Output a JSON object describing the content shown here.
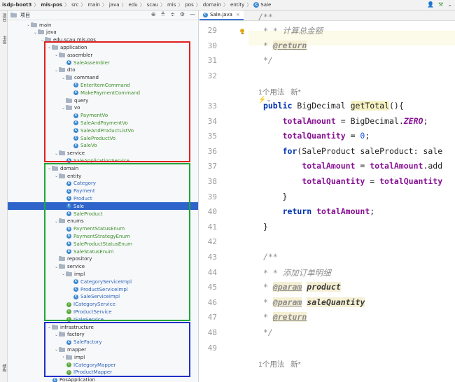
{
  "breadcrumb": {
    "items": [
      "isdp-boot3",
      "mis-pos",
      "src",
      "main",
      "java",
      "edu",
      "scau",
      "mis",
      "pos",
      "domain",
      "entity",
      "Sale"
    ],
    "separator": "〉"
  },
  "left_strip": {
    "labels": [
      "项目",
      "书签",
      "结构"
    ]
  },
  "project_panel": {
    "title": "项目",
    "tools": [
      "⊕",
      "≚",
      "≑",
      "⚙",
      "—"
    ]
  },
  "tree": {
    "rows": [
      {
        "label": "main",
        "icon": "folder",
        "depth": 0,
        "arrow": "⌄",
        "color": ""
      },
      {
        "label": "java",
        "icon": "folder",
        "depth": 1,
        "arrow": "⌄",
        "color": ""
      },
      {
        "label": "edu.scau.mis.pos",
        "icon": "folder",
        "depth": 2,
        "arrow": "⌄",
        "color": ""
      },
      {
        "label": "application",
        "icon": "folder",
        "depth": 3,
        "arrow": "⌄",
        "color": ""
      },
      {
        "label": "assembler",
        "icon": "folder",
        "depth": 4,
        "arrow": "⌄",
        "color": ""
      },
      {
        "label": "SaleAssembler",
        "icon": "class",
        "depth": 5,
        "arrow": "",
        "color": "green"
      },
      {
        "label": "dto",
        "icon": "folder",
        "depth": 4,
        "arrow": "⌄",
        "color": ""
      },
      {
        "label": "command",
        "icon": "folder",
        "depth": 5,
        "arrow": "⌄",
        "color": ""
      },
      {
        "label": "EnterItemCommand",
        "icon": "class",
        "depth": 6,
        "arrow": "",
        "color": "green"
      },
      {
        "label": "MakePaymentCommand",
        "icon": "class",
        "depth": 6,
        "arrow": "",
        "color": "green"
      },
      {
        "label": "query",
        "icon": "folder",
        "depth": 5,
        "arrow": "",
        "color": ""
      },
      {
        "label": "vo",
        "icon": "folder",
        "depth": 5,
        "arrow": "⌄",
        "color": ""
      },
      {
        "label": "PaymentVo",
        "icon": "class",
        "depth": 6,
        "arrow": "",
        "color": "green"
      },
      {
        "label": "SaleAndPaymentVo",
        "icon": "class",
        "depth": 6,
        "arrow": "",
        "color": "green"
      },
      {
        "label": "SaleAndProductListVo",
        "icon": "class",
        "depth": 6,
        "arrow": "",
        "color": "green"
      },
      {
        "label": "SaleProductVo",
        "icon": "class",
        "depth": 6,
        "arrow": "",
        "color": "green"
      },
      {
        "label": "SaleVo",
        "icon": "class",
        "depth": 6,
        "arrow": "",
        "color": "green"
      },
      {
        "label": "service",
        "icon": "folder",
        "depth": 4,
        "arrow": "⌄",
        "color": ""
      },
      {
        "label": "SaleApplicationService",
        "icon": "class",
        "depth": 5,
        "arrow": "",
        "color": "green"
      },
      {
        "label": "domain",
        "icon": "folder",
        "depth": 3,
        "arrow": "⌄",
        "color": ""
      },
      {
        "label": "entity",
        "icon": "folder",
        "depth": 4,
        "arrow": "⌄",
        "color": ""
      },
      {
        "label": "Category",
        "icon": "class",
        "depth": 5,
        "arrow": "",
        "color": "blue"
      },
      {
        "label": "Payment",
        "icon": "class",
        "depth": 5,
        "arrow": "",
        "color": "blue"
      },
      {
        "label": "Product",
        "icon": "class",
        "depth": 5,
        "arrow": "",
        "color": "blue"
      },
      {
        "label": "Sale",
        "icon": "class",
        "depth": 5,
        "arrow": "",
        "color": "",
        "selected": true
      },
      {
        "label": "SaleProduct",
        "icon": "class",
        "depth": 5,
        "arrow": "",
        "color": "green"
      },
      {
        "label": "enums",
        "icon": "folder",
        "depth": 4,
        "arrow": "⌄",
        "color": ""
      },
      {
        "label": "PaymentStatusEnum",
        "icon": "enum",
        "depth": 5,
        "arrow": "",
        "color": "green"
      },
      {
        "label": "PaymentStrategyEnum",
        "icon": "enum",
        "depth": 5,
        "arrow": "",
        "color": "green"
      },
      {
        "label": "SaleProductStatusEnum",
        "icon": "enum",
        "depth": 5,
        "arrow": "",
        "color": "green"
      },
      {
        "label": "SaleStatusEnum",
        "icon": "enum",
        "depth": 5,
        "arrow": "",
        "color": "green"
      },
      {
        "label": "repository",
        "icon": "folder",
        "depth": 4,
        "arrow": "",
        "color": ""
      },
      {
        "label": "service",
        "icon": "folder",
        "depth": 4,
        "arrow": "⌄",
        "color": ""
      },
      {
        "label": "impl",
        "icon": "folder",
        "depth": 5,
        "arrow": "⌄",
        "color": ""
      },
      {
        "label": "CategoryServiceImpl",
        "icon": "class",
        "depth": 6,
        "arrow": "",
        "color": "blue"
      },
      {
        "label": "ProductServiceImpl",
        "icon": "class",
        "depth": 6,
        "arrow": "",
        "color": "blue"
      },
      {
        "label": "SaleServiceImpl",
        "icon": "class",
        "depth": 6,
        "arrow": "",
        "color": "blue"
      },
      {
        "label": "ICategoryService",
        "icon": "interface",
        "depth": 5,
        "arrow": "",
        "color": "blue"
      },
      {
        "label": "IProductService",
        "icon": "interface",
        "depth": 5,
        "arrow": "",
        "color": "blue"
      },
      {
        "label": "ISaleService",
        "icon": "interface",
        "depth": 5,
        "arrow": "",
        "color": "blue"
      },
      {
        "label": "infrastructure",
        "icon": "folder",
        "depth": 3,
        "arrow": "⌄",
        "color": ""
      },
      {
        "label": "factory",
        "icon": "folder",
        "depth": 4,
        "arrow": "⌄",
        "color": ""
      },
      {
        "label": "SaleFactory",
        "icon": "class",
        "depth": 5,
        "arrow": "",
        "color": "blue"
      },
      {
        "label": "mapper",
        "icon": "folder",
        "depth": 4,
        "arrow": "⌄",
        "color": ""
      },
      {
        "label": "impl",
        "icon": "folder",
        "depth": 5,
        "arrow": "›",
        "color": ""
      },
      {
        "label": "ICategoryMapper",
        "icon": "interface",
        "depth": 5,
        "arrow": "",
        "color": "blue"
      },
      {
        "label": "IProductMapper",
        "icon": "interface",
        "depth": 5,
        "arrow": "",
        "color": "blue"
      },
      {
        "label": "PosApplication",
        "icon": "class",
        "depth": 3,
        "arrow": "",
        "color": ""
      }
    ]
  },
  "annotations": {
    "red": "#e02020",
    "green": "#22a63a",
    "blue": "#2230c8"
  },
  "editor": {
    "tab_label": "Sale.java",
    "tab_close": "×",
    "lines": [
      {
        "n": "29",
        "kind": "doc1"
      },
      {
        "n": "30",
        "kind": "doc-return"
      },
      {
        "n": "31",
        "kind": "doc-end"
      },
      {
        "n": "32",
        "kind": "blank"
      },
      {
        "n": "",
        "kind": "hint"
      },
      {
        "n": "33",
        "kind": "sig"
      },
      {
        "n": "34",
        "kind": "assign1"
      },
      {
        "n": "35",
        "kind": "assign2"
      },
      {
        "n": "36",
        "kind": "for"
      },
      {
        "n": "37",
        "kind": "body1"
      },
      {
        "n": "38",
        "kind": "body2"
      },
      {
        "n": "39",
        "kind": "close-inner"
      },
      {
        "n": "40",
        "kind": "return"
      },
      {
        "n": "41",
        "kind": "close-method"
      },
      {
        "n": "42",
        "kind": "blank"
      },
      {
        "n": "43",
        "kind": "doc-start"
      },
      {
        "n": "44",
        "kind": "doc2"
      },
      {
        "n": "45",
        "kind": "doc-param1"
      },
      {
        "n": "46",
        "kind": "doc-param2"
      },
      {
        "n": "47",
        "kind": "doc-return2"
      },
      {
        "n": "48",
        "kind": "doc-end2"
      },
      {
        "n": "49",
        "kind": "blank"
      },
      {
        "n": "",
        "kind": "hint2"
      }
    ],
    "text": {
      "top_comment": "/**",
      "doc1": "* 计算总金额",
      "doc_return_tag": "@return",
      "doc_end": "*/",
      "hint_usage": "1个用法",
      "hint_new": "新*",
      "sig_public": "public",
      "sig_type": "BigDecimal",
      "sig_method": "getTotal",
      "sig_rest": "(){",
      "fld_amount": "totalAmount",
      "eq": " = ",
      "bigdec": "BigDecimal.",
      "zero": "ZERO",
      "semi": ";",
      "fld_qty": "totalQuantity",
      "zero_num": "0",
      "for_kw": "for",
      "for_rest": "(SaleProduct saleProduct: sale",
      "body1_rest": ".add",
      "body2_rest": "totalQuantity",
      "close_brace": "}",
      "return_kw": "return",
      "doc_start": "/**",
      "doc2": "* 添加订单明细",
      "param_tag": "@param",
      "param1": "product",
      "param2": "saleQuantity",
      "star": "* "
    }
  }
}
